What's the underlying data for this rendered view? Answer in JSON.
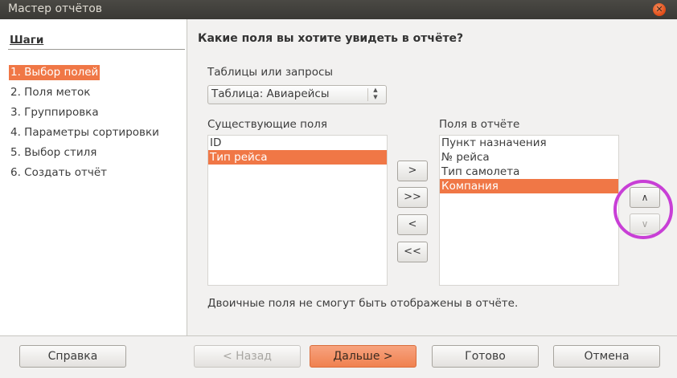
{
  "window": {
    "title": "Мастер отчётов",
    "close_icon": "close-icon"
  },
  "sidebar": {
    "title": "Шаги",
    "steps": [
      {
        "label": "1. Выбор полей",
        "active": true
      },
      {
        "label": "2. Поля меток",
        "active": false
      },
      {
        "label": "3. Группировка",
        "active": false
      },
      {
        "label": "4. Параметры сортировки",
        "active": false
      },
      {
        "label": "5. Выбор стиля",
        "active": false
      },
      {
        "label": "6. Создать отчёт",
        "active": false
      }
    ]
  },
  "main": {
    "question": "Какие поля вы хотите увидеть в отчёте?",
    "tables_label": "Таблицы или запросы",
    "tables_value": "Таблица: Авиарейсы",
    "existing_label": "Существующие поля",
    "existing_fields": [
      "ID",
      "Тип рейса"
    ],
    "existing_selected": "Тип рейса",
    "report_label": "Поля в отчёте",
    "report_fields": [
      "Пункт назначения",
      "№ рейса",
      "Тип самолета",
      "Компания"
    ],
    "report_selected": "Компания",
    "note": "Двоичные поля не смогут быть отображены в отчёте.",
    "move": {
      "add": ">",
      "add_all": ">>",
      "remove": "<",
      "remove_all": "<<"
    },
    "order": {
      "up": "^",
      "down": "v"
    }
  },
  "footer": {
    "help": "Справка",
    "back": "< Назад",
    "next": "Дальше >",
    "finish": "Готово",
    "cancel": "Отмена"
  },
  "annotation": {
    "color": "#c83fd6"
  }
}
